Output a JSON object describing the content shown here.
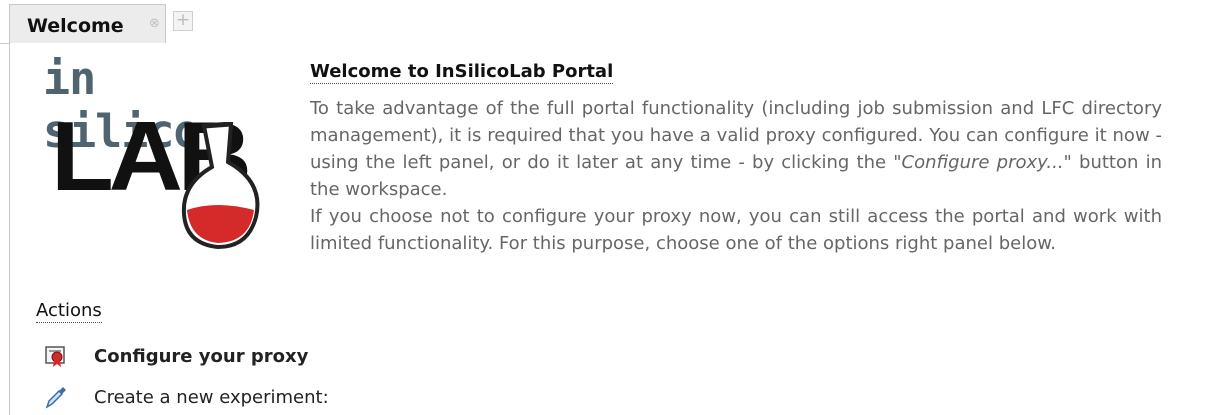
{
  "tabbar": {
    "tab_label": "Welcome",
    "close_glyph": "⊗",
    "add_glyph": "+"
  },
  "logo": {
    "line1": "in silico",
    "line2": "LAB"
  },
  "welcome": {
    "title": "Welcome to InSilicoLab Portal",
    "para1_prefix": "To take advantage of the full portal functionality (including job submission and LFC directory management), it is required that you have a valid proxy configured. You can configure it now - using the left panel, or do it later at any time - by clicking the ",
    "para1_em": "\"Configure proxy...\"",
    "para1_suffix": " button in the workspace.",
    "para2": "If you choose not to configure your proxy now, you can still access the portal and work with limited functionality. For this purpose, choose one of the options right panel below."
  },
  "actions": {
    "title": "Actions",
    "items": [
      {
        "label": "Configure your proxy",
        "icon": "certificate-icon"
      },
      {
        "label": "Create a new experiment:",
        "icon": "pipette-icon"
      }
    ]
  },
  "colors": {
    "tab_bg": "#ececec",
    "border": "#c9c9c9",
    "body_text": "#666666",
    "logo_text": "#4f6470",
    "flask_red": "#d42a2a"
  }
}
